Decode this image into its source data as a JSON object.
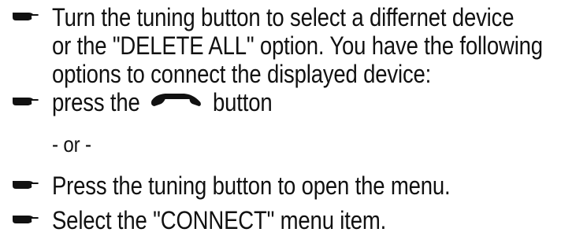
{
  "instructions": {
    "step1_line1": "Turn the tuning button to select a differnet device",
    "step1_line2": "or  the \"DELETE ALL\" option.  You have the following",
    "step1_line3": "options to connect the displayed device:",
    "step2_prefix": "press the",
    "step2_suffix": "button",
    "separator": "- or -",
    "step3": "Press the tuning button  to open the menu.",
    "step4": "Select the \"CONNECT\" menu item."
  },
  "icons": {
    "bullet": "pointing-hand-icon",
    "phone": "phone-handset-icon"
  },
  "colors": {
    "text": "#111111",
    "background": "#ffffff"
  }
}
